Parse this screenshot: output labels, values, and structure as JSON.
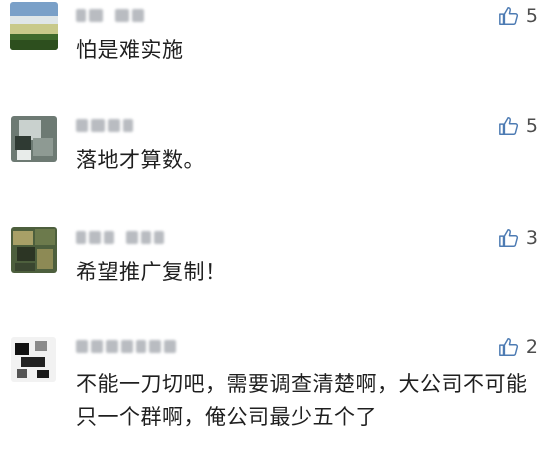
{
  "comments": [
    {
      "text": "怕是难实施",
      "likes": "5",
      "avatar_colors": [
        "#7aa0c8",
        "#c8c98a",
        "#3f6a2c"
      ]
    },
    {
      "text": "落地才算数。",
      "likes": "5",
      "avatar_colors": [
        "#6d7a73",
        "#c9d1ce",
        "#2f3a33"
      ]
    },
    {
      "text": "希望推广复制！",
      "likes": "3",
      "avatar_colors": [
        "#4d5f3d",
        "#a8a067",
        "#2c3524"
      ]
    },
    {
      "text": "不能一刀切吧，需要调查清楚啊，大公司不可能只一个群啊，俺公司最少五个了",
      "likes": "2",
      "avatar_colors": [
        "#f2f2f2",
        "#111111",
        "#8a8a8a"
      ]
    }
  ],
  "colors": {
    "like_icon": "#4d7bb3",
    "like_count": "#4d4d4d",
    "nickname_blur": "#b9bcc1",
    "text": "#1f1f1f"
  }
}
